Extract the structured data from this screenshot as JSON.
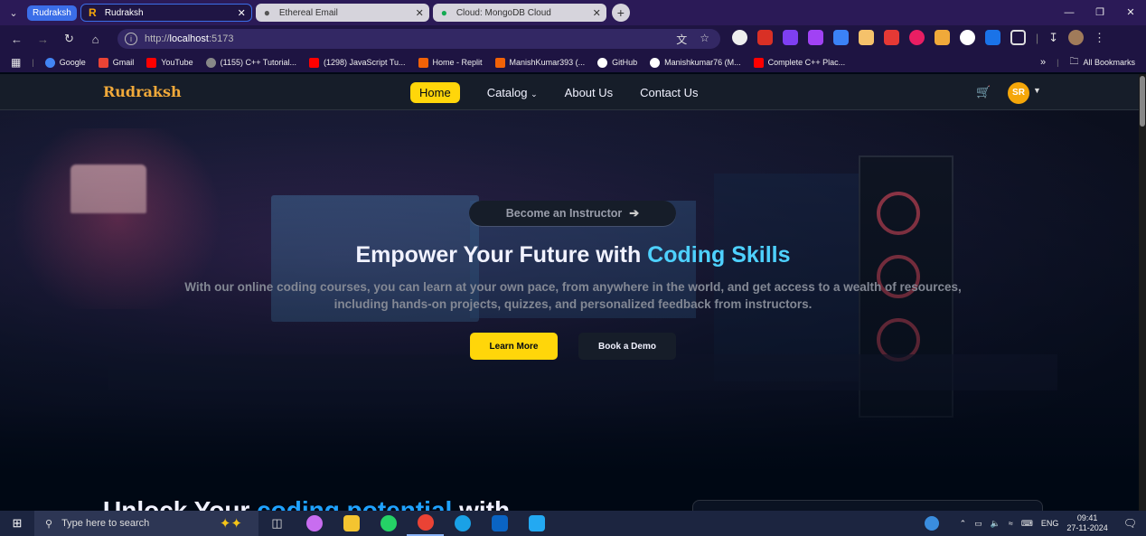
{
  "browser": {
    "tab_group": "Rudraksh",
    "tabs": [
      {
        "title": "Rudraksh",
        "active": true
      },
      {
        "title": "Ethereal Email",
        "active": false
      },
      {
        "title": "Cloud: MongoDB Cloud",
        "active": false
      }
    ],
    "url_scheme": "http://",
    "url_host": "localhost",
    "url_port": ":5173",
    "bookmarks": [
      {
        "label": "Google",
        "color": "#4285f4"
      },
      {
        "label": "Gmail",
        "color": "#ea4335"
      },
      {
        "label": "YouTube",
        "color": "#ff0000"
      },
      {
        "label": "(1155) C++ Tutorial...",
        "color": "#888888"
      },
      {
        "label": "(1298) JavaScript Tu...",
        "color": "#ff0000"
      },
      {
        "label": "Home - Replit",
        "color": "#f26207"
      },
      {
        "label": "ManishKumar393 (...",
        "color": "#f26207"
      },
      {
        "label": "GitHub",
        "color": "#ffffff"
      },
      {
        "label": "Manishkumar76 (M...",
        "color": "#ffffff"
      },
      {
        "label": "Complete C++ Plac...",
        "color": "#ff0000"
      }
    ],
    "all_bookmarks": "All Bookmarks"
  },
  "navbar": {
    "logo": "Rudraksh",
    "links": [
      "Home",
      "Catalog",
      "About Us",
      "Contact Us"
    ],
    "avatar_initials": "SR"
  },
  "hero": {
    "instructor_button": "Become an Instructor",
    "title_part1": "Empower Your Future with ",
    "title_highlight": "Coding Skills",
    "subtitle": "With our online coding courses, you can learn at your own pace, from anywhere in the world, and get access to a wealth of resources, including hands-on projects, quizzes, and personalized feedback from instructors.",
    "learn_more": "Learn More",
    "book_demo": "Book a Demo"
  },
  "section2": {
    "title_part1": "Unlock Your ",
    "title_highlight": "coding potential",
    "title_part2": " with"
  },
  "taskbar": {
    "search_placeholder": "Type here to search",
    "language": "ENG",
    "time": "09:41",
    "date": "27-11-2024"
  },
  "colors": {
    "accent_yellow": "#ffd60a",
    "highlight_blue": "#4ed1ff",
    "logo_orange": "#f0a93a",
    "avatar": "#f5a70a"
  }
}
